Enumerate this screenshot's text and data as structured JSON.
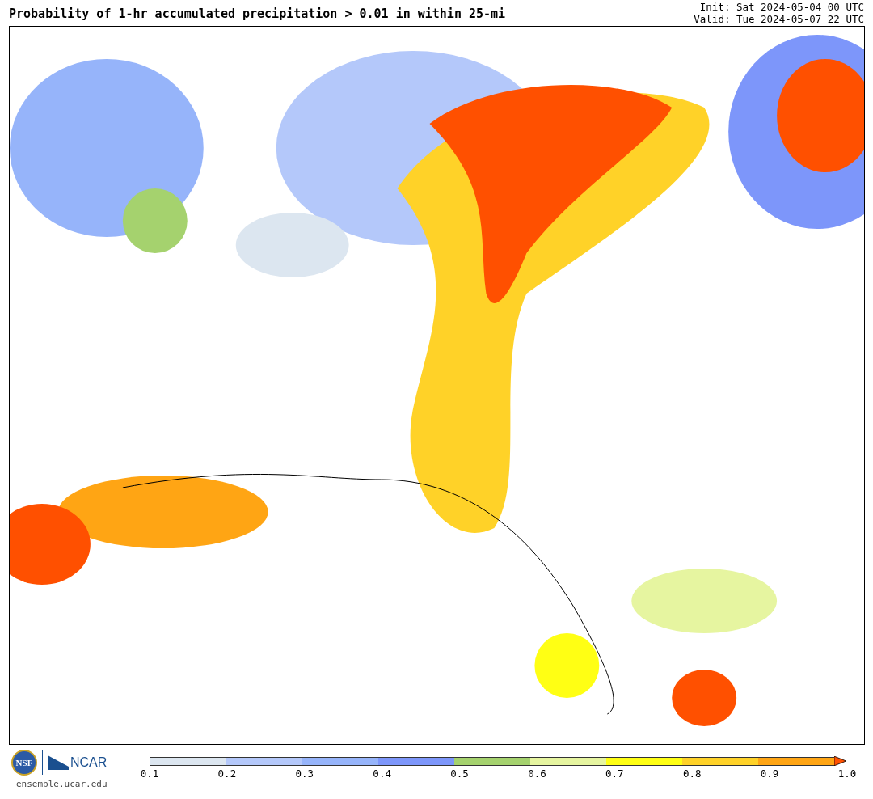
{
  "title": "Probability of 1-hr accumulated precipitation > 0.01 in within 25-mi",
  "init": "Init: Sat 2024-05-04 00 UTC",
  "valid": "Valid: Tue 2024-05-07 22 UTC",
  "logos": {
    "nsf": "NSF",
    "ncar": "NCAR",
    "url": "ensemble.ucar.edu"
  },
  "colorbar": {
    "segments": [
      {
        "color": "#dce6f0"
      },
      {
        "color": "#b4c8fa"
      },
      {
        "color": "#96b4fa"
      },
      {
        "color": "#7d96fa"
      },
      {
        "color": "#a5d26e"
      },
      {
        "color": "#e6f5a0"
      },
      {
        "color": "#ffff14"
      },
      {
        "color": "#ffd228"
      },
      {
        "color": "#ffa514"
      },
      {
        "kind": "extension",
        "color": "#ff5000"
      }
    ],
    "ticks": [
      "0.1",
      "0.2",
      "0.3",
      "0.4",
      "0.5",
      "0.6",
      "0.7",
      "0.8",
      "0.9",
      "1.0"
    ]
  }
}
